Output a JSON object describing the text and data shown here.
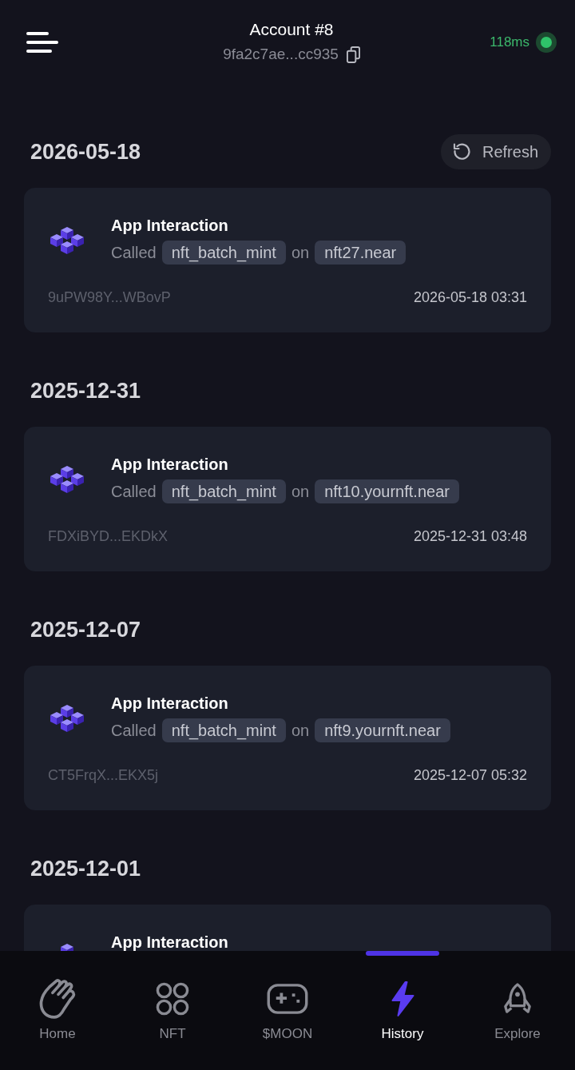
{
  "header": {
    "title": "Account #8",
    "address": "9fa2c7ae...cc935",
    "latency": "118ms",
    "connected": true
  },
  "history": {
    "refresh_button": "Refresh",
    "groups": [
      {
        "date": "2026-05-18",
        "transactions": [
          {
            "title": "App Interaction",
            "action": "Called",
            "method": "nft_batch_mint",
            "connector": "on",
            "contract": "nft27.near",
            "hash": "9uPW98Y...WBovP",
            "time": "2026-05-18 03:31"
          }
        ]
      },
      {
        "date": "2025-12-31",
        "transactions": [
          {
            "title": "App Interaction",
            "action": "Called",
            "method": "nft_batch_mint",
            "connector": "on",
            "contract": "nft10.yournft.near",
            "hash": "FDXiBYD...EKDkX",
            "time": "2025-12-31 03:48"
          }
        ]
      },
      {
        "date": "2025-12-07",
        "transactions": [
          {
            "title": "App Interaction",
            "action": "Called",
            "method": "nft_batch_mint",
            "connector": "on",
            "contract": "nft9.yournft.near",
            "hash": "CT5FrqX...EKX5j",
            "time": "2025-12-07 05:32"
          }
        ]
      },
      {
        "date": "2025-12-01",
        "transactions": [
          {
            "title": "App Interaction"
          }
        ]
      }
    ]
  },
  "nav": {
    "items": [
      {
        "label": "Home",
        "selected": false
      },
      {
        "label": "NFT",
        "selected": false
      },
      {
        "label": "$MOON",
        "selected": false
      },
      {
        "label": "History",
        "selected": true
      },
      {
        "label": "Explore",
        "selected": false
      }
    ]
  }
}
